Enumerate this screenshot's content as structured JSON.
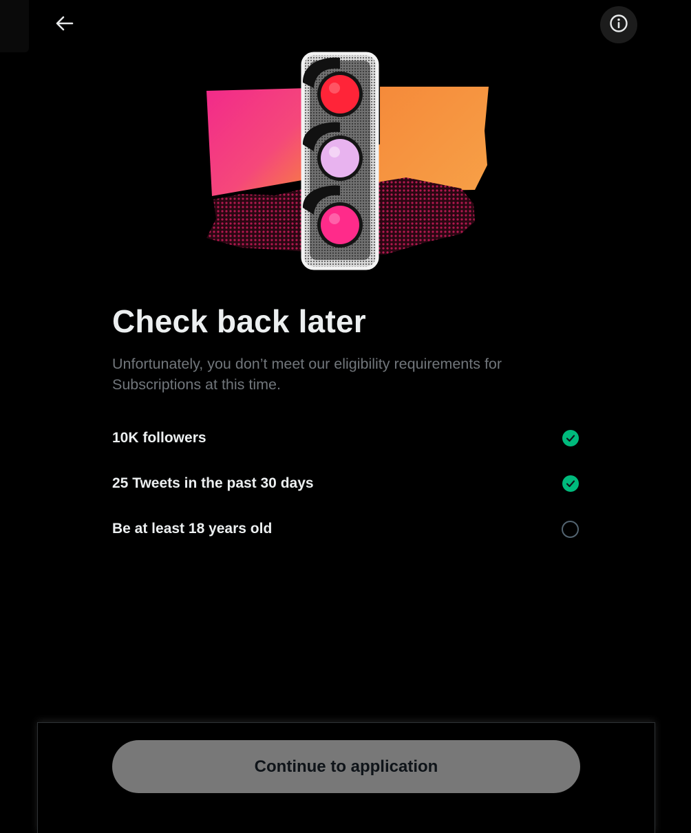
{
  "header": {
    "back_icon": "arrow-left-icon",
    "info_icon": "info-circle-icon"
  },
  "hero": {
    "illustration": "traffic-light-illustration",
    "colors": {
      "pink": "#f0388f",
      "orange": "#f7923a",
      "light_red": "#ff2a3c",
      "light_lilac": "#e7b2ef",
      "light_magenta": "#ff2d8b"
    }
  },
  "main": {
    "title": "Check back later",
    "subtitle": "Unfortunately, you don’t meet our eligibility requirements for Subscriptions at this time.",
    "requirements": [
      {
        "label": "10K followers",
        "met": true
      },
      {
        "label": "25 Tweets in the past 30 days",
        "met": true
      },
      {
        "label": "Be at least 18 years old",
        "met": false
      }
    ]
  },
  "footer": {
    "continue_label": "Continue to application"
  },
  "colors": {
    "background": "#000000",
    "check_green": "#00ba7c",
    "muted_text": "#71767b",
    "button_disabled": "#787878"
  }
}
